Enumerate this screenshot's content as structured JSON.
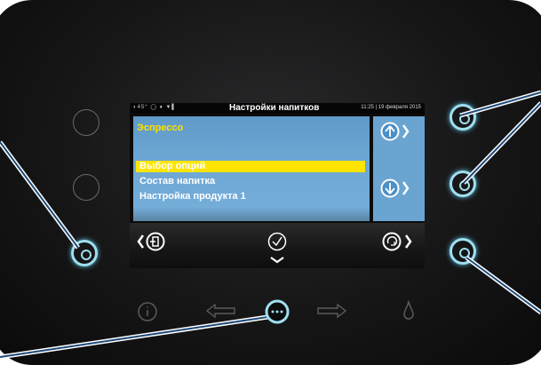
{
  "status_bar": {
    "indicators": "◐45° ◯  ♦  ▼▌",
    "title": "Настройки напитков",
    "datetime": "11:25 | 19 февраля 2015"
  },
  "menu": {
    "title": "Эспрессо",
    "items": [
      {
        "label": "Выбор опций",
        "selected": true
      },
      {
        "label": "Состав напитка",
        "selected": false
      },
      {
        "label": "Настройка продукта 1",
        "selected": false
      }
    ]
  },
  "icons": {
    "up": "up-arrow-icon",
    "down": "down-arrow-icon",
    "exit": "exit-icon",
    "confirm": "check-icon",
    "refresh": "refresh-icon",
    "chev_left": "chevron-left-icon",
    "chev_right": "chevron-right-icon"
  },
  "colors": {
    "panel": "#161617",
    "screen_blue": "#6ba5d2",
    "title_yellow": "#ffe000",
    "highlight": "#ffe400",
    "lit_ring": "#9fdff0"
  }
}
